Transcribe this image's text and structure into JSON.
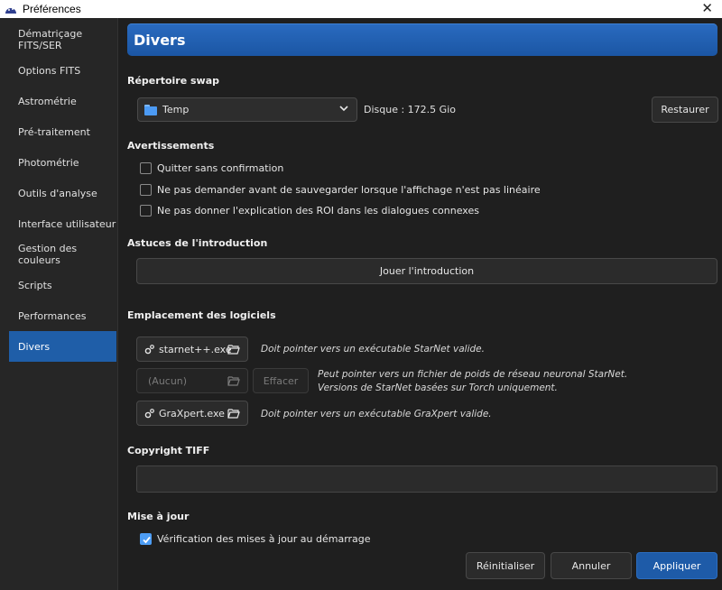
{
  "window": {
    "title": "Préférences",
    "close": "✕"
  },
  "sidebar": {
    "items": [
      {
        "label": "Dématriçage FITS/SER"
      },
      {
        "label": "Options FITS"
      },
      {
        "label": "Astrométrie"
      },
      {
        "label": "Pré-traitement"
      },
      {
        "label": "Photométrie"
      },
      {
        "label": "Outils d'analyse"
      },
      {
        "label": "Interface utilisateur"
      },
      {
        "label": "Gestion des couleurs"
      },
      {
        "label": "Scripts"
      },
      {
        "label": "Performances"
      },
      {
        "label": "Divers"
      }
    ],
    "active_index": 10
  },
  "page": {
    "title": "Divers"
  },
  "swap": {
    "section": "Répertoire swap",
    "folder": "Temp",
    "disk": "Disque : 172.5 Gio",
    "restore": "Restaurer"
  },
  "warnings": {
    "section": "Avertissements",
    "items": [
      {
        "label": "Quitter sans confirmation",
        "checked": false
      },
      {
        "label": "Ne pas demander avant de sauvegarder lorsque l'affichage n'est pas linéaire",
        "checked": false
      },
      {
        "label": "Ne pas donner l'explication des ROI dans les dialogues connexes",
        "checked": false
      }
    ]
  },
  "intro": {
    "section": "Astuces de l'introduction",
    "play": "Jouer l'introduction"
  },
  "software": {
    "section": "Emplacement des logiciels",
    "starnet": {
      "label": "starnet++.exe",
      "hint": "Doit pointer vers un exécutable StarNet valide."
    },
    "weights": {
      "label": "(Aucun)",
      "clear": "Effacer",
      "hint1": "Peut pointer vers un fichier de poids de réseau neuronal StarNet.",
      "hint2": "Versions de StarNet basées sur Torch uniquement."
    },
    "graxpert": {
      "label": "GraXpert.exe",
      "hint": "Doit pointer vers un exécutable GraXpert valide."
    }
  },
  "tiff": {
    "section": "Copyright TIFF",
    "value": ""
  },
  "update": {
    "section": "Mise à jour",
    "check_label": "Vérification des mises à jour au démarrage",
    "checked": true
  },
  "footer": {
    "reset": "Réinitialiser",
    "cancel": "Annuler",
    "apply": "Appliquer"
  },
  "colors": {
    "accent": "#1f5ea8",
    "background": "#1f1f1f",
    "checkbox": "#4d9df5"
  }
}
